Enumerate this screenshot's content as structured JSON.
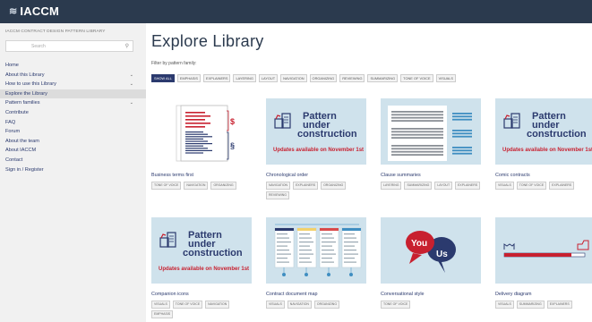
{
  "header": {
    "logo_text": "IACCM"
  },
  "sidebar": {
    "title": "IACCM CONTRACT DESIGN PATTERN LIBRARY",
    "search_placeholder": "Search",
    "items": [
      {
        "label": "Home",
        "chevron": false,
        "active": false
      },
      {
        "label": "About this Library",
        "chevron": true,
        "active": false
      },
      {
        "label": "How to use this Library",
        "chevron": true,
        "active": false
      },
      {
        "label": "Explore the Library",
        "chevron": false,
        "active": true
      },
      {
        "label": "Pattern families",
        "chevron": true,
        "active": false
      },
      {
        "label": "Contribute",
        "chevron": false,
        "active": false
      },
      {
        "label": "FAQ",
        "chevron": false,
        "active": false
      },
      {
        "label": "Forum",
        "chevron": false,
        "active": false
      },
      {
        "label": "About the team",
        "chevron": false,
        "active": false
      },
      {
        "label": "About IACCM",
        "chevron": false,
        "active": false
      },
      {
        "label": "Contact",
        "chevron": false,
        "active": false
      },
      {
        "label": "Sign in / Register",
        "chevron": false,
        "active": false
      }
    ]
  },
  "main": {
    "title": "Explore Library",
    "filter_label": "Filter by pattern family:",
    "filters": [
      "SHOW ALL",
      "EMPHASIS",
      "EXPLAINERS",
      "LAYERING",
      "LAYOUT",
      "NAVIGATION",
      "ORGANIZING",
      "REVIEWING",
      "SUMMARIZING",
      "TONE OF VOICE",
      "VISUALS"
    ],
    "puc": {
      "line1": "Pattern",
      "line2": "under",
      "line3": "construction",
      "note": "Updates available on November 1st"
    },
    "speech": {
      "a": "You",
      "b": "Us"
    },
    "cards": [
      {
        "title": "Business terms first",
        "tags": [
          "TONE OF VOICE",
          "NAVIGATION",
          "ORGANIZING"
        ],
        "thumb": "business"
      },
      {
        "title": "Chronological order",
        "tags": [
          "NAVIGATION",
          "EXPLAINERS",
          "ORGANIZING",
          "REVIEWING"
        ],
        "thumb": "puc"
      },
      {
        "title": "Clause summaries",
        "tags": [
          "LAYERING",
          "SUMMARIZING",
          "LAYOUT",
          "EXPLAINERS"
        ],
        "thumb": "clause"
      },
      {
        "title": "Comic contracts",
        "tags": [
          "VISUALS",
          "TONE OF VOICE",
          "EXPLAINERS"
        ],
        "thumb": "puc"
      },
      {
        "title": "Companion icons",
        "tags": [
          "VISUALS",
          "TONE OF VOICE",
          "NAVIGATION",
          "EMPHASIS"
        ],
        "thumb": "puc"
      },
      {
        "title": "Contract document map",
        "tags": [
          "VISUALS",
          "NAVIGATION",
          "ORGANIZING"
        ],
        "thumb": "map"
      },
      {
        "title": "Conversational style",
        "tags": [
          "TONE OF VOICE"
        ],
        "thumb": "speech"
      },
      {
        "title": "Delivery diagram",
        "tags": [
          "VISUALS",
          "SUMMARIZING",
          "EXPLAINERS"
        ],
        "thumb": "delivery"
      }
    ]
  }
}
